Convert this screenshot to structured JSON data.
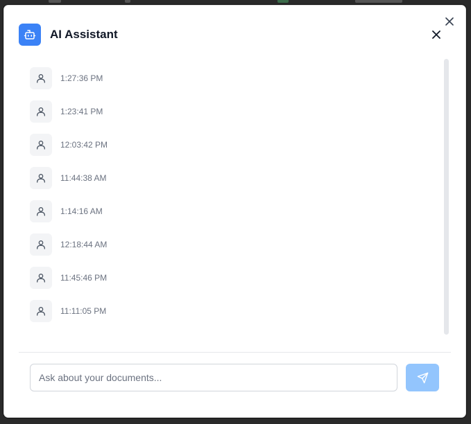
{
  "dialog": {
    "title": "AI Assistant",
    "header_icon": "bot-icon",
    "close_icon": "close-icon",
    "accent_color": "#3b82f6",
    "send_button_color": "#93c5fd"
  },
  "messages": [
    {
      "sender_icon": "user-icon",
      "time": "1:27:36 PM"
    },
    {
      "sender_icon": "user-icon",
      "time": "1:23:41 PM"
    },
    {
      "sender_icon": "user-icon",
      "time": "12:03:42 PM"
    },
    {
      "sender_icon": "user-icon",
      "time": "11:44:38 AM"
    },
    {
      "sender_icon": "user-icon",
      "time": "1:14:16 AM"
    },
    {
      "sender_icon": "user-icon",
      "time": "12:18:44 AM"
    },
    {
      "sender_icon": "user-icon",
      "time": "11:45:46 PM"
    },
    {
      "sender_icon": "user-icon",
      "time": "11:11:05 PM"
    }
  ],
  "composer": {
    "placeholder": "Ask about your documents...",
    "value": "",
    "send_icon": "send-icon"
  }
}
